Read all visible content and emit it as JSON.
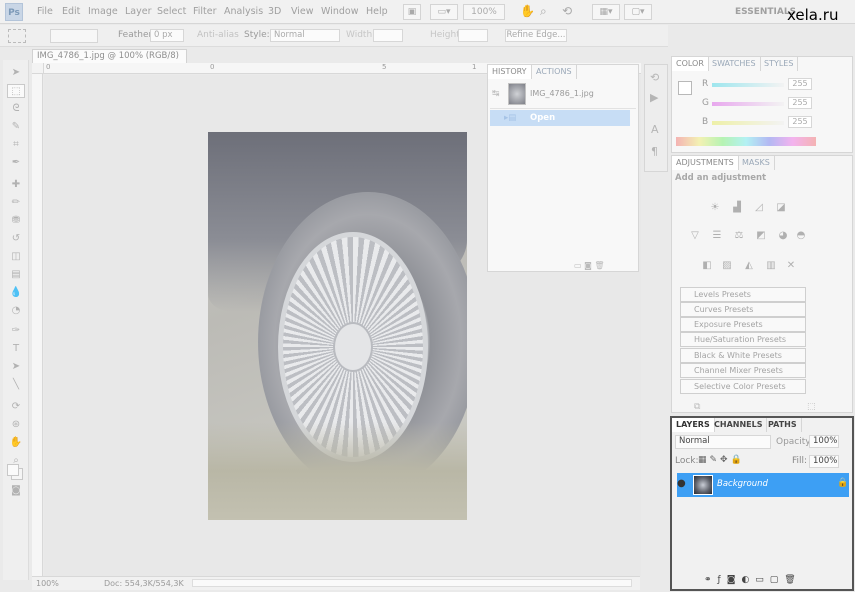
{
  "app": {
    "logo": "Ps",
    "workspace": "ESSENTIALS"
  },
  "menu": [
    "File",
    "Edit",
    "Image",
    "Layer",
    "Select",
    "Filter",
    "Analysis",
    "3D",
    "View",
    "Window",
    "Help"
  ],
  "appbar": {
    "zoom": "100%"
  },
  "watermark": "xela.ru",
  "options": {
    "feather_label": "Feather:",
    "feather_value": "0 px",
    "antialias_label": "Anti-alias",
    "style_label": "Style:",
    "style_value": "Normal",
    "width_label": "Width:",
    "height_label": "Height:",
    "refine_edge": "Refine Edge..."
  },
  "document": {
    "tab_title": "IMG_4786_1.jpg @ 100% (RGB/8)",
    "close": "×"
  },
  "rulers": {
    "h_ticks": [
      "0",
      "0",
      "5",
      "1"
    ]
  },
  "status": {
    "zoom": "100%",
    "doc": "Doc: 554,3K/554,3K"
  },
  "history": {
    "tabs": [
      "HISTORY",
      "ACTIONS"
    ],
    "snapshot": "IMG_4786_1.jpg",
    "items": [
      "Open"
    ]
  },
  "color": {
    "tabs": [
      "COLOR",
      "SWATCHES",
      "STYLES"
    ],
    "channels": [
      {
        "label": "R",
        "value": "255"
      },
      {
        "label": "G",
        "value": "255"
      },
      {
        "label": "B",
        "value": "255"
      }
    ],
    "colors": {
      "r": "#9ee6ee",
      "g": "#e8a8ee",
      "b": "#eef0a8"
    }
  },
  "adjustments": {
    "tabs": [
      "ADJUSTMENTS",
      "MASKS"
    ],
    "heading": "Add an adjustment",
    "presets": [
      "Levels Presets",
      "Curves Presets",
      "Exposure Presets",
      "Hue/Saturation Presets",
      "Black & White Presets",
      "Channel Mixer Presets",
      "Selective Color Presets"
    ]
  },
  "layers": {
    "tabs": [
      "LAYERS",
      "CHANNELS",
      "PATHS"
    ],
    "blend_mode": "Normal",
    "opacity_label": "Opacity:",
    "opacity_value": "100%",
    "lock_label": "Lock:",
    "fill_label": "Fill:",
    "fill_value": "100%",
    "layer_name": "Background",
    "footer_icons": [
      "link-icon",
      "fx-icon",
      "mask-icon",
      "adjustment-icon",
      "group-icon",
      "new-layer-icon",
      "trash-icon"
    ]
  }
}
